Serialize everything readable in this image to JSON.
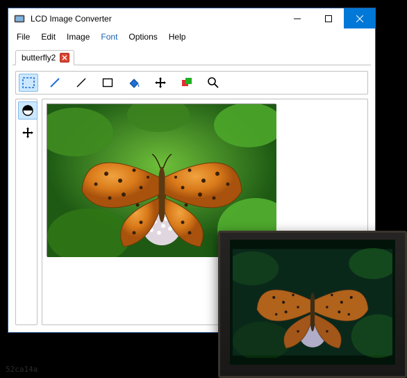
{
  "window": {
    "title": "LCD Image Converter"
  },
  "menu": {
    "file": "File",
    "edit": "Edit",
    "image": "Image",
    "font": "Font",
    "options": "Options",
    "help": "Help"
  },
  "tabs": [
    {
      "label": "butterfly2"
    }
  ],
  "toolbar": {
    "items": [
      "select-rect",
      "pencil",
      "line",
      "rectangle",
      "fill",
      "move",
      "color",
      "zoom"
    ]
  },
  "sidetools": {
    "items": [
      "fill-tool",
      "move-tool"
    ]
  },
  "watermark": "52ca14a"
}
